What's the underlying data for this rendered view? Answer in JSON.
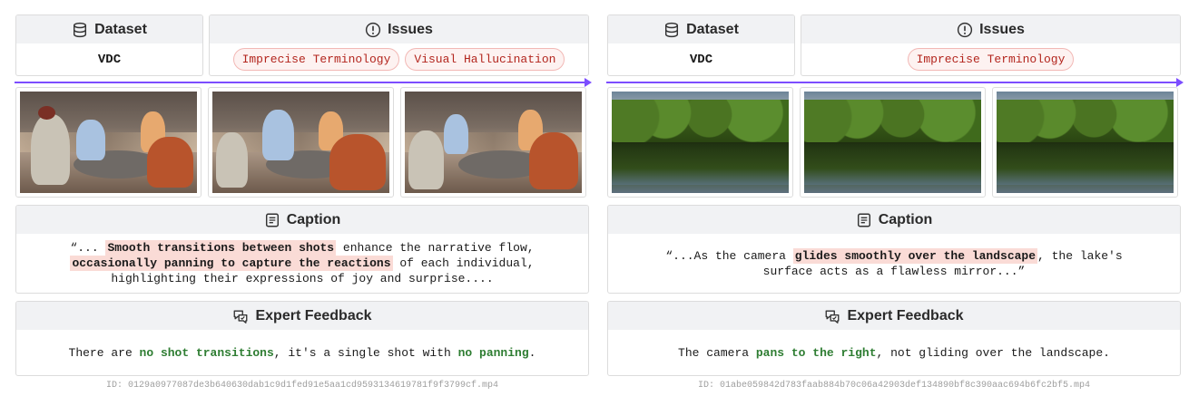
{
  "panels": [
    {
      "dataset_label": "Dataset",
      "dataset_value": "VDC",
      "issues_label": "Issues",
      "issue_tags": [
        "Imprecise Terminology",
        "Visual Hallucination"
      ],
      "caption_label": "Caption",
      "caption_parts": {
        "p1": "“... ",
        "h1": "Smooth transitions between shots",
        "p2": " enhance the narrative flow,",
        "h2": "occasionally panning to capture the reactions",
        "p3": " of each individual,",
        "p4": "highlighting their expressions of joy and surprise...."
      },
      "feedback_label": "Expert Feedback",
      "feedback_parts": {
        "t1": "There are ",
        "g1": "no shot transitions",
        "t2": ", it's a single shot with ",
        "g2": "no panning",
        "t3": "."
      },
      "video_id": "ID: 0129a0977087de3b640630dab1c9d1fed91e5aa1cd9593134619781f9f3799cf.mp4"
    },
    {
      "dataset_label": "Dataset",
      "dataset_value": "VDC",
      "issues_label": "Issues",
      "issue_tags": [
        "Imprecise Terminology"
      ],
      "caption_label": "Caption",
      "caption_parts": {
        "p1": "“...As the camera ",
        "h1": "glides smoothly over the landscape",
        "p2": ", the lake's",
        "p3": "surface acts as a flawless mirror...”"
      },
      "feedback_label": "Expert Feedback",
      "feedback_parts": {
        "t1": "The camera ",
        "g1": "pans to the right",
        "t2": ", not gliding over the landscape."
      },
      "video_id": "ID: 01abe059842d783faab884b70c06a42903def134890bf8c390aac694b6fc2bf5.mp4"
    }
  ],
  "icons": {
    "dataset": "database-icon",
    "issues": "exclamation-circle-icon",
    "caption": "document-text-icon",
    "feedback": "chat-bubbles-icon"
  },
  "colors": {
    "timeline": "#7c4dff",
    "tag_text": "#b3261e",
    "highlight": "#fadbd6",
    "positive": "#2e7d32"
  }
}
